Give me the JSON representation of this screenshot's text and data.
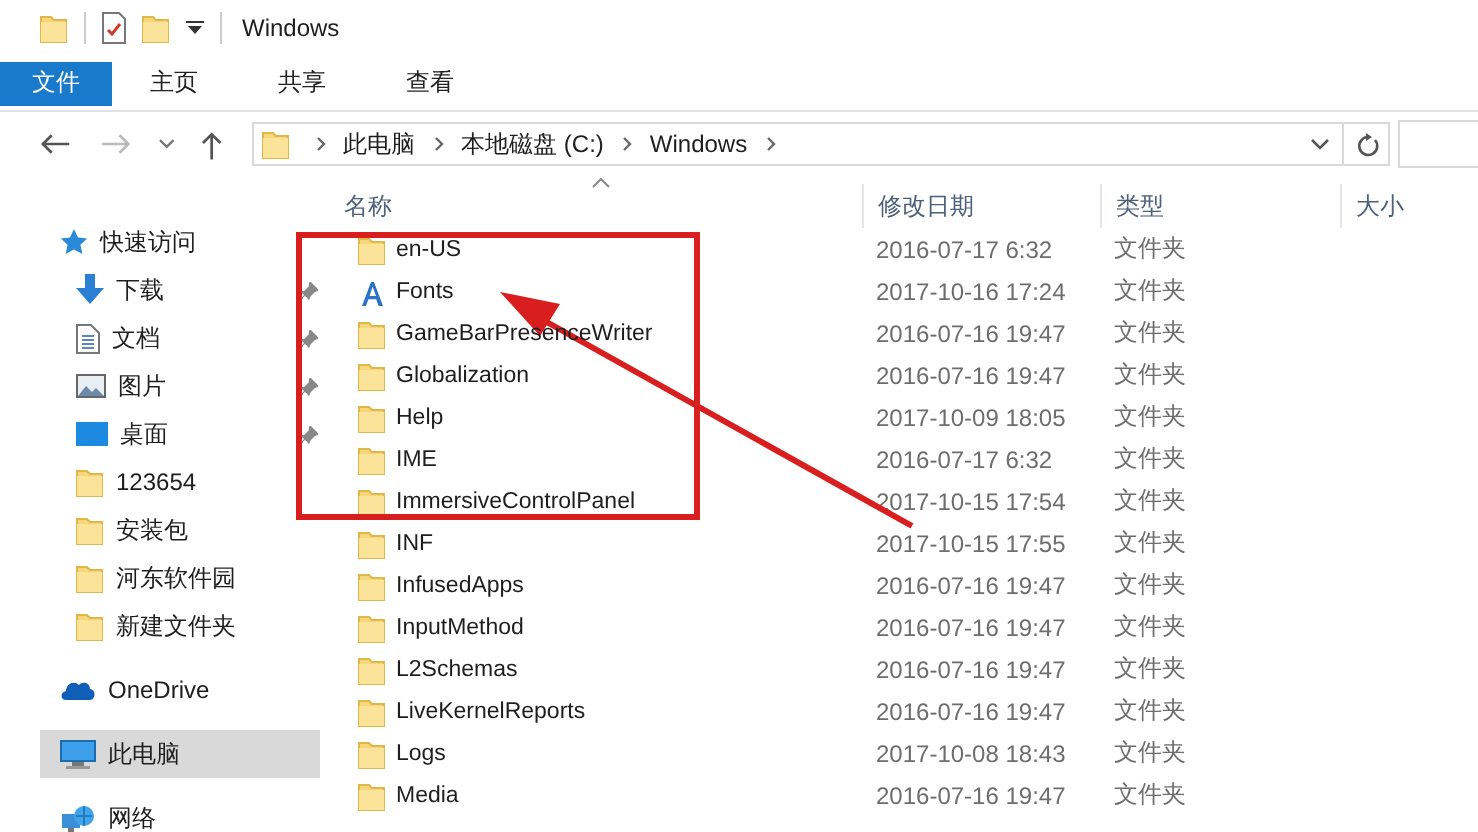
{
  "window": {
    "title": "Windows"
  },
  "ribbon_tabs": [
    {
      "label": "文件",
      "kind": "file",
      "selected": false
    },
    {
      "label": "主页",
      "kind": "tab",
      "selected": false
    },
    {
      "label": "共享",
      "kind": "tab",
      "selected": false
    },
    {
      "label": "查看",
      "kind": "tab",
      "selected": false
    }
  ],
  "address": {
    "breadcrumbs": [
      "此电脑",
      "本地磁盘 (C:)",
      "Windows"
    ]
  },
  "sidebar": {
    "items": [
      {
        "label": "快速访问",
        "kind": "quick",
        "pinned": false,
        "selected": false
      },
      {
        "label": "下载",
        "kind": "download",
        "pinned": true,
        "selected": false
      },
      {
        "label": "文档",
        "kind": "document",
        "pinned": true,
        "selected": false
      },
      {
        "label": "图片",
        "kind": "pictures",
        "pinned": true,
        "selected": false
      },
      {
        "label": "桌面",
        "kind": "desktop",
        "pinned": true,
        "selected": false
      },
      {
        "label": "123654",
        "kind": "folder",
        "pinned": false,
        "selected": false
      },
      {
        "label": "安装包",
        "kind": "folder",
        "pinned": false,
        "selected": false
      },
      {
        "label": "河东软件园",
        "kind": "folder",
        "pinned": false,
        "selected": false
      },
      {
        "label": "新建文件夹",
        "kind": "folder",
        "pinned": false,
        "selected": false
      },
      {
        "label": "OneDrive",
        "kind": "onedrive",
        "pinned": false,
        "selected": false
      },
      {
        "label": "此电脑",
        "kind": "pc",
        "pinned": false,
        "selected": true
      },
      {
        "label": "网络",
        "kind": "network",
        "pinned": false,
        "selected": false
      }
    ]
  },
  "table": {
    "columns": [
      "名称",
      "修改日期",
      "类型",
      "大小"
    ],
    "rows": [
      {
        "name": "en-US",
        "kind": "folder",
        "date": "2016-07-17 6:32",
        "type": "文件夹"
      },
      {
        "name": "Fonts",
        "kind": "fonts",
        "date": "2017-10-16 17:24",
        "type": "文件夹"
      },
      {
        "name": "GameBarPresenceWriter",
        "kind": "folder",
        "date": "2016-07-16 19:47",
        "type": "文件夹"
      },
      {
        "name": "Globalization",
        "kind": "folder",
        "date": "2016-07-16 19:47",
        "type": "文件夹"
      },
      {
        "name": "Help",
        "kind": "folder",
        "date": "2017-10-09 18:05",
        "type": "文件夹"
      },
      {
        "name": "IME",
        "kind": "folder",
        "date": "2016-07-17 6:32",
        "type": "文件夹"
      },
      {
        "name": "ImmersiveControlPanel",
        "kind": "folder",
        "date": "2017-10-15 17:54",
        "type": "文件夹"
      },
      {
        "name": "INF",
        "kind": "folder",
        "date": "2017-10-15 17:55",
        "type": "文件夹"
      },
      {
        "name": "InfusedApps",
        "kind": "folder",
        "date": "2016-07-16 19:47",
        "type": "文件夹"
      },
      {
        "name": "InputMethod",
        "kind": "folder",
        "date": "2016-07-16 19:47",
        "type": "文件夹"
      },
      {
        "name": "L2Schemas",
        "kind": "folder",
        "date": "2016-07-16 19:47",
        "type": "文件夹"
      },
      {
        "name": "LiveKernelReports",
        "kind": "folder",
        "date": "2016-07-16 19:47",
        "type": "文件夹"
      },
      {
        "name": "Logs",
        "kind": "folder",
        "date": "2017-10-08 18:43",
        "type": "文件夹"
      },
      {
        "name": "Media",
        "kind": "folder",
        "date": "2016-07-16 19:47",
        "type": "文件夹"
      }
    ]
  },
  "annotation": {
    "highlight_box": true,
    "arrow": true
  }
}
